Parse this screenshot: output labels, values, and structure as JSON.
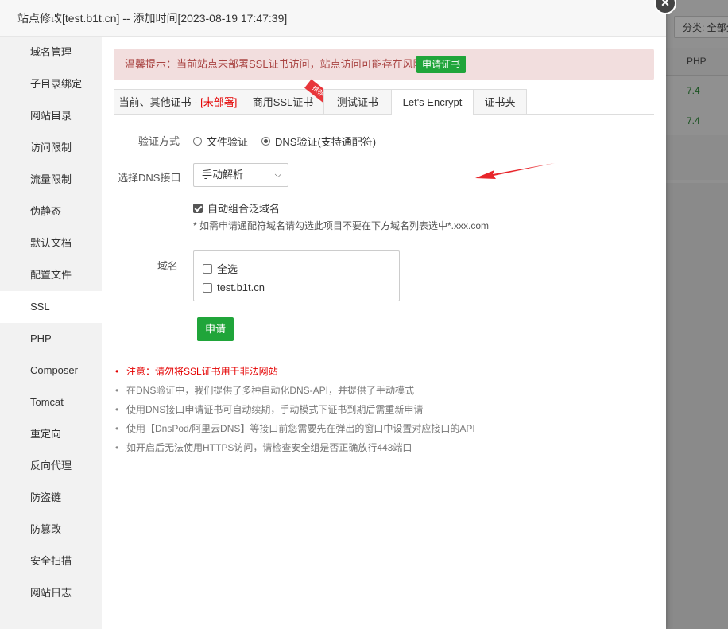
{
  "background": {
    "filter_label": "分类: 全部分类",
    "column_header": "PHP",
    "rows": [
      "7.4",
      "7.4"
    ]
  },
  "modal": {
    "title": "站点修改[test.b1t.cn] -- 添加时间[2023-08-19 17:47:39]",
    "close_icon": "×"
  },
  "sidebar": {
    "items": [
      {
        "label": "域名管理"
      },
      {
        "label": "子目录绑定"
      },
      {
        "label": "网站目录"
      },
      {
        "label": "访问限制"
      },
      {
        "label": "流量限制"
      },
      {
        "label": "伪静态"
      },
      {
        "label": "默认文档"
      },
      {
        "label": "配置文件"
      },
      {
        "label": "SSL"
      },
      {
        "label": "PHP"
      },
      {
        "label": "Composer"
      },
      {
        "label": "Tomcat"
      },
      {
        "label": "重定向"
      },
      {
        "label": "反向代理"
      },
      {
        "label": "防盗链"
      },
      {
        "label": "防篡改"
      },
      {
        "label": "安全扫描"
      },
      {
        "label": "网站日志"
      }
    ],
    "active": "SSL"
  },
  "alert": {
    "text": "温馨提示：当前站点未部署SSL证书访问，站点访问可能存在风险。",
    "button": "申请证书"
  },
  "tabs": {
    "current": {
      "label": "当前、其他证书 - ",
      "status": "[未部署]"
    },
    "commercial": {
      "label": "商用SSL证书",
      "badge": "推荐"
    },
    "test": {
      "label": "测试证书"
    },
    "letsencrypt": {
      "label": "Let's Encrypt"
    },
    "folder": {
      "label": "证书夹"
    },
    "active": "Let's Encrypt"
  },
  "form": {
    "verify_label": "验证方式",
    "verify_options": [
      "文件验证",
      "DNS验证(支持通配符)"
    ],
    "verify_selected": "DNS验证(支持通配符)",
    "dns_label": "选择DNS接口",
    "dns_value": "手动解析",
    "wildcard_checkbox": "自动组合泛域名",
    "wildcard_checked": true,
    "hint": "* 如需申请通配符域名请勾选此项目不要在下方域名列表选中*.xxx.com",
    "domain_label": "域名",
    "domain_options": [
      {
        "label": "全选",
        "checked": false
      },
      {
        "label": "test.b1t.cn",
        "checked": false
      }
    ],
    "apply_button": "申请"
  },
  "notes": [
    "注意：请勿将SSL证书用于非法网站",
    "在DNS验证中，我们提供了多种自动化DNS-API，并提供了手动模式",
    "使用DNS接口申请证书可自动续期，手动模式下证书到期后需重新申请",
    "使用【DnsPod/阿里云DNS】等接口前您需要先在弹出的窗口中设置对应接口的API",
    "如开启后无法使用HTTPS访问，请检查安全组是否正确放行443端口"
  ],
  "colors": {
    "accent_green": "#20a53a",
    "alert_bg": "#f2dede",
    "alert_text": "#a94442",
    "warning_red": "#e40000",
    "arrow_red": "#e8262b"
  }
}
